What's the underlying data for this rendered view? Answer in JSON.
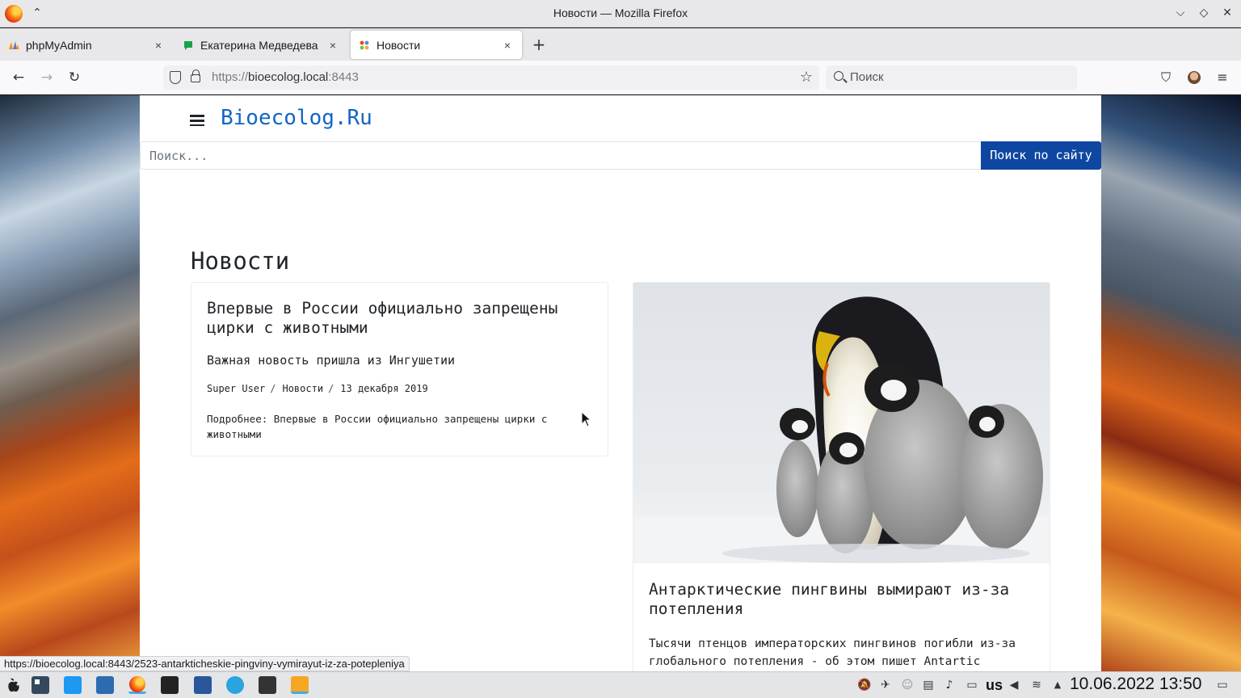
{
  "window": {
    "title": "Новости — Mozilla Firefox",
    "buttons": {
      "minimize": "⌵",
      "maximize": "◇",
      "close": "✕"
    }
  },
  "tabs": [
    {
      "label": "phpMyAdmin",
      "close": "×",
      "icon": "phpmyadmin-icon"
    },
    {
      "label": "Екатерина Медведева - ",
      "close": "×",
      "icon": "chat-icon"
    },
    {
      "label": "Новости",
      "close": "×",
      "icon": "joomla-icon",
      "active": true
    }
  ],
  "newtab": "+",
  "nav": {
    "back": "←",
    "forward": "→",
    "reload": "↻",
    "url_scheme": "https://",
    "url_host": "bioecolog.local",
    "url_port": ":8443",
    "bookmark_star": "☆",
    "search_placeholder": "Поиск",
    "pocket": "⛉",
    "menu": "≡"
  },
  "site": {
    "logo": "Bioecolog.Ru",
    "search_placeholder": "Поиск...",
    "search_button": "Поиск по сайту",
    "heading": "Новости",
    "accent_color": "#0d47a1",
    "logo_color": "#1266c4"
  },
  "articles": [
    {
      "title": "Впервые в России официально запрещены цирки с животными",
      "lead": "Важная новость пришла из Ингушетии",
      "author": "Super User",
      "category": "Новости",
      "date": "13 декабря 2019",
      "sep": "/",
      "more": "Подробнее: Впервые в России официально запрещены цирки с животными"
    },
    {
      "title": "Антарктические пингвины вымирают из-за потепления",
      "lead": "Тысячи птенцов императорских пингвинов погибли из-за глобального потепления - об этом пишет Antartic",
      "image": "emperor-penguins-photo"
    }
  ],
  "status_link": "https://bioecolog.local:8443/2523-antarkticheskie-pingviny-vymirayut-iz-za-potepleniya",
  "taskbar": {
    "keyboard_layout": "us",
    "clock": "10.06.2022 13:50"
  }
}
